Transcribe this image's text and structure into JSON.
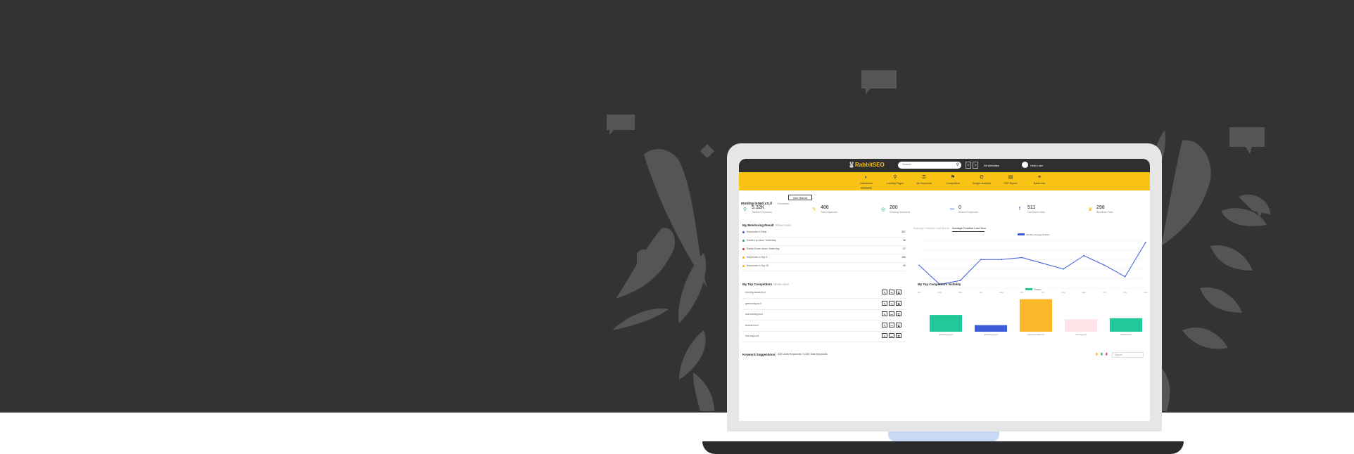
{
  "app": {
    "logo_text": "RabbitSEO",
    "search_placeholder": "Search",
    "prev_glyph": "<",
    "next_glyph": ">",
    "website_selector": "All Websites",
    "user_greeting": "Hello User"
  },
  "menu": [
    {
      "label": "Dashboard",
      "icon": "dashboard-icon",
      "glyph": "◐",
      "active": true
    },
    {
      "label": "Landing Pages",
      "icon": "pin-icon",
      "glyph": "⚲"
    },
    {
      "label": "My Keywords",
      "icon": "key-icon",
      "glyph": "⚿"
    },
    {
      "label": "Competitors",
      "icon": "competitors-icon",
      "glyph": "⚑"
    },
    {
      "label": "Google Analytics",
      "icon": "analytics-icon",
      "glyph": "G"
    },
    {
      "label": "PDF Report",
      "icon": "report-icon",
      "glyph": "▤"
    },
    {
      "label": "BackLinks",
      "icon": "backlinks-icon",
      "glyph": "⚭"
    }
  ],
  "domain": {
    "name": "moving-israel.co.il",
    "section": "Overview",
    "manual_button": "User Manual"
  },
  "stats": [
    {
      "value": "5.32K",
      "label": "Tracked Keywords",
      "icon": "search-graph-icon",
      "glyph": "⚲",
      "color": "#1fae6a"
    },
    {
      "value": "486",
      "label": "Total Keywords",
      "icon": "keys-icon",
      "glyph": "✎",
      "color": "#f4b400"
    },
    {
      "value": "280",
      "label": "Ranking Keywords",
      "icon": "target-icon",
      "glyph": "◎",
      "color": "#1fae6a"
    },
    {
      "value": "0",
      "label": "Shared Keywords",
      "icon": "link-icon",
      "glyph": "⚯",
      "color": "#4b7bec"
    },
    {
      "value": "511",
      "label": "Facebook Likes",
      "icon": "facebook-icon",
      "glyph": "f",
      "color": "#3b5bdb"
    },
    {
      "value": "298",
      "label": "Backlinks Total",
      "icon": "trophy-icon",
      "glyph": "♛",
      "color": "#f4b400"
    }
  ],
  "monitoring": {
    "title": "My Monitoring Result",
    "subtitle": "Show more",
    "rows": [
      {
        "label": "Keywords in Total",
        "value": "357",
        "color": "#3b5bdb"
      },
      {
        "label": "Ranks Up since Yesterday",
        "value": "36",
        "color": "#1fae6a"
      },
      {
        "label": "Ranks Down since Yesterday",
        "value": "27",
        "color": "#e03131"
      },
      {
        "label": "Keywords in Top 3",
        "value": "180",
        "color": "#f4b400"
      },
      {
        "label": "Keywords in Top 10",
        "value": "90",
        "color": "#f4b400"
      }
    ]
  },
  "position_tabs": {
    "inactive": "Average Position Last Month",
    "active": "Average Position Last Year"
  },
  "competitors": {
    "title": "My Top Competitors",
    "subtitle": "Show more",
    "rows": [
      "moving-israel.co.il",
      "gamoving.co.il",
      "ost-moving.co.il",
      "hovelet.co.il",
      "indi.org.co.il"
    ],
    "btn_edit": "✎",
    "btn_link": "⚯",
    "btn_view": "⧉"
  },
  "visibility": {
    "title": "My Top Competitors Visibility"
  },
  "keywords": {
    "title": "Keyword Suggestions",
    "summary": "325 Listed Keywords / 5,326 Total Keywords",
    "search_placeholder": "Search"
  },
  "chart_data": [
    {
      "type": "line",
      "title": "Average Position Last Year",
      "series": [
        {
          "name": "Monthly Average Position",
          "color": "#3b5bdb",
          "values": [
            22,
            12,
            14,
            25,
            25,
            26,
            23,
            20,
            27,
            22,
            16,
            34
          ]
        }
      ],
      "categories": [
        "Jan",
        "Feb",
        "Mar",
        "Apr",
        "May",
        "Jun",
        "Jul",
        "Aug",
        "Sep",
        "Oct",
        "Nov",
        "Dec"
      ],
      "ylim": [
        10,
        35
      ],
      "grid": true,
      "legend": "top"
    },
    {
      "type": "bar",
      "title": "My Top Competitors Visibility",
      "categories": [
        "gamoving.co.il",
        "gamoving.co.il",
        "moving-israel.co.il",
        "ost-mg.co.il",
        "hovelet.co.il"
      ],
      "series": [
        {
          "name": "Visibility",
          "values": [
            46,
            18,
            89,
            34,
            37
          ]
        }
      ],
      "colors": [
        "#20c997",
        "#3b5bdb",
        "#fab82a",
        "#ffe3e8",
        "#20c997"
      ],
      "ylim": [
        0,
        100
      ],
      "legend": "top"
    }
  ]
}
